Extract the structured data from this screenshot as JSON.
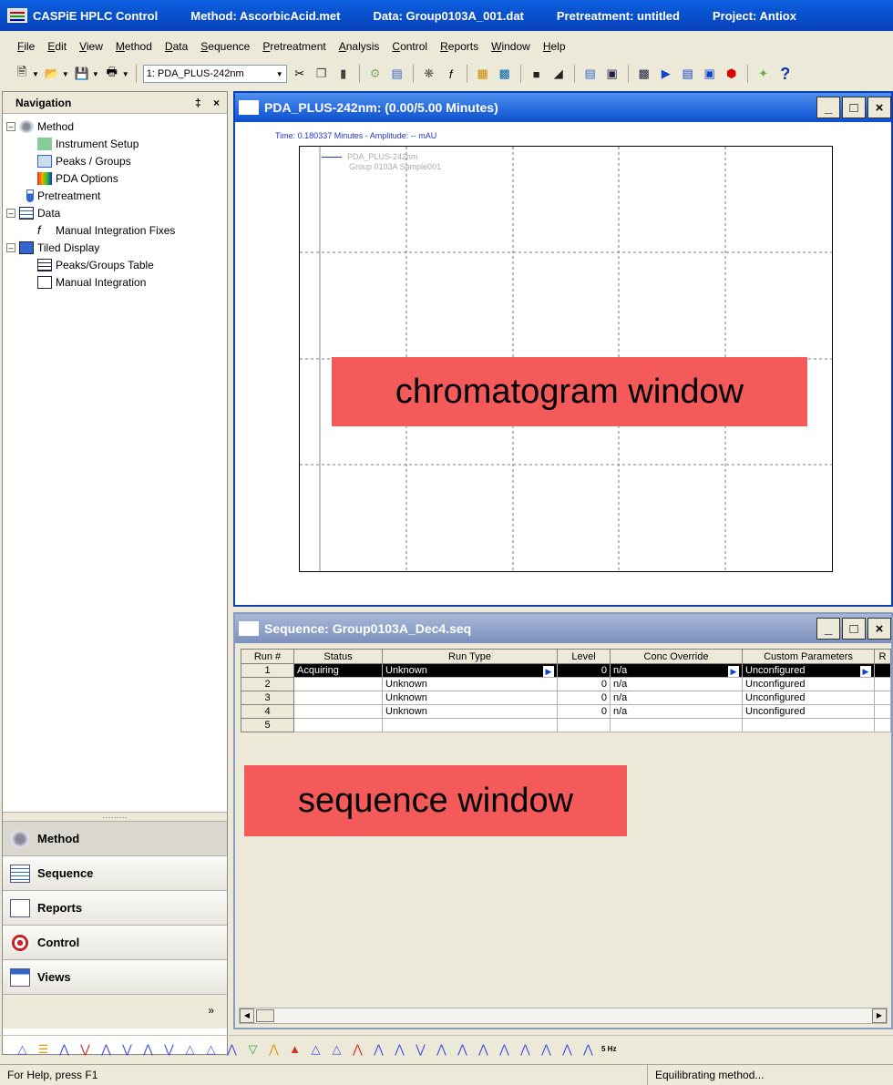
{
  "titlebar": {
    "app": "CASPiE HPLC Control",
    "method": "Method: AscorbicAcid.met",
    "data": "Data: Group0103A_001.dat",
    "pretreatment": "Pretreatment: untitled",
    "project": "Project: Antiox"
  },
  "menu": [
    "File",
    "Edit",
    "View",
    "Method",
    "Data",
    "Sequence",
    "Pretreatment",
    "Analysis",
    "Control",
    "Reports",
    "Window",
    "Help"
  ],
  "toolbar": {
    "channel_select": "1: PDA_PLUS-242nm",
    "help_glyph": "?"
  },
  "nav": {
    "title": "Navigation",
    "pin_glyph": "‡",
    "close_glyph": "×",
    "tree": {
      "method": "Method",
      "instrument_setup": "Instrument Setup",
      "peaks_groups": "Peaks / Groups",
      "pda_options": "PDA Options",
      "pretreatment": "Pretreatment",
      "data": "Data",
      "manual_integration_fixes": "Manual Integration Fixes",
      "tiled_display": "Tiled Display",
      "peaks_groups_table": "Peaks/Groups Table",
      "manual_integration": "Manual Integration"
    },
    "splitter_grip": "·········",
    "buttons": [
      "Method",
      "Sequence",
      "Reports",
      "Control",
      "Views"
    ],
    "more_glyph": "»"
  },
  "chromatogram": {
    "title": "PDA_PLUS-242nm: (0.00/5.00 Minutes)",
    "cursor_readout": "Time: 0.180337 Minutes - Amplitude: -- mAU",
    "legend_line1": "PDA_PLUS-242nm",
    "legend_line2": "Group 0103A Sample001",
    "overlay_label": "chromatogram window",
    "series_color": "#2233cc"
  },
  "sequence": {
    "title": "Sequence: Group0103A_Dec4.seq",
    "columns": [
      "Run #",
      "Status",
      "Run Type",
      "Level",
      "Conc Override",
      "Custom Parameters",
      "R"
    ],
    "rows": [
      {
        "run": "1",
        "status": "Acquiring",
        "run_type": "Unknown",
        "level": "0",
        "conc": "n/a",
        "custom": "Unconfigured"
      },
      {
        "run": "2",
        "status": "",
        "run_type": "Unknown",
        "level": "0",
        "conc": "n/a",
        "custom": "Unconfigured"
      },
      {
        "run": "3",
        "status": "",
        "run_type": "Unknown",
        "level": "0",
        "conc": "n/a",
        "custom": "Unconfigured"
      },
      {
        "run": "4",
        "status": "",
        "run_type": "Unknown",
        "level": "0",
        "conc": "n/a",
        "custom": "Unconfigured"
      },
      {
        "run": "5",
        "status": "",
        "run_type": "",
        "level": "",
        "conc": "",
        "custom": ""
      }
    ],
    "overlay_label": "sequence window"
  },
  "window_controls": {
    "minimize": "_",
    "maximize": "□",
    "close": "×"
  },
  "int_toolbar": {
    "rate_label": "5 Hz"
  },
  "status": {
    "left": "For Help, press F1",
    "right": "Equilibrating method..."
  }
}
